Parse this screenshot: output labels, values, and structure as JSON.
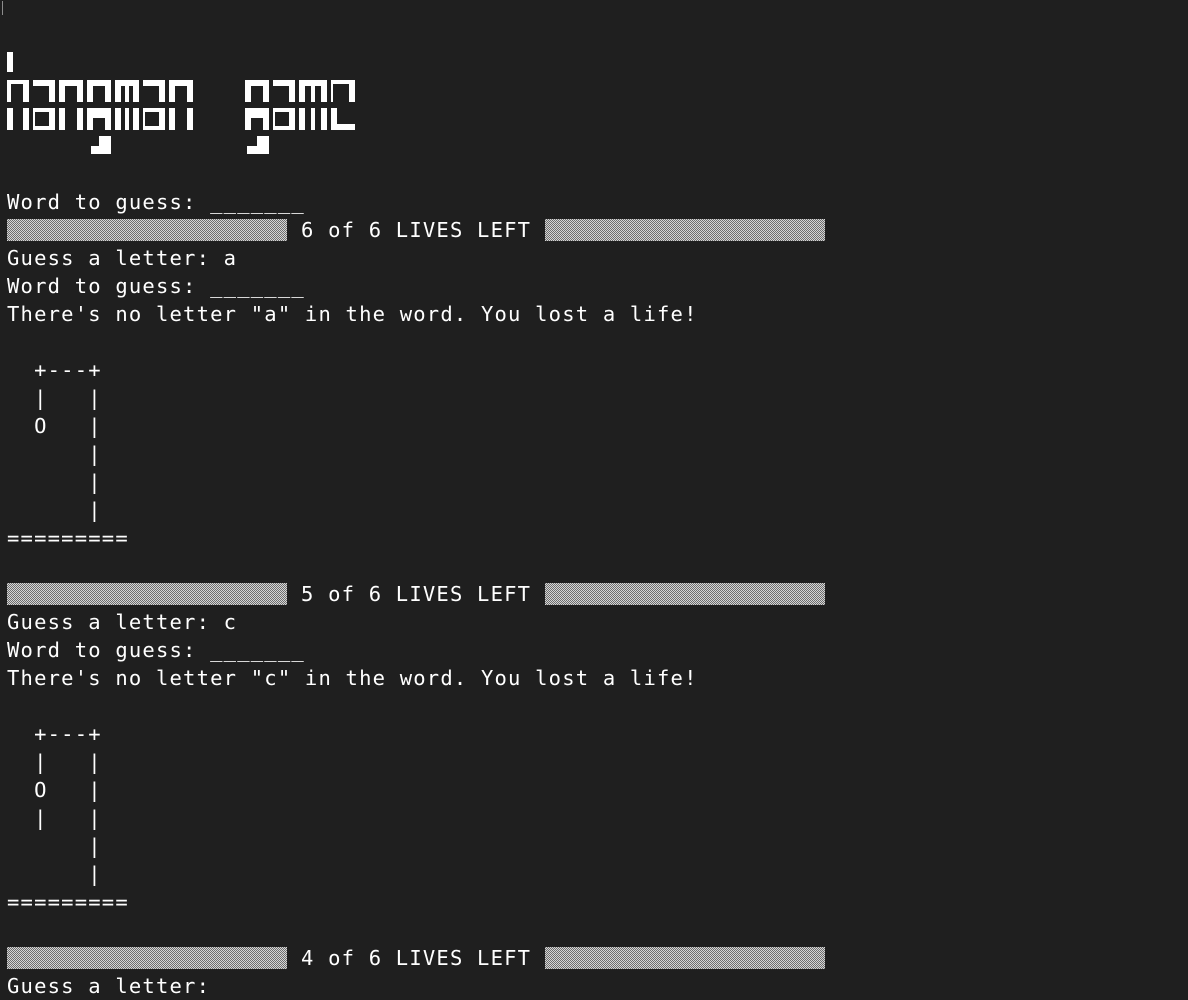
{
  "terminal": {
    "banner_text": "hangman game",
    "initial_word_line": "Word to guess: _______",
    "turns": [
      {
        "lives": "6 of 6 LIVES LEFT",
        "guess_line": "Guess a letter: a",
        "word_line": "Word to guess: _______",
        "message": "There's no letter \"a\" in the word. You lost a life!",
        "gallows": "  +---+\n  |   |\n  O   |\n      |\n      |\n      |\n========="
      },
      {
        "lives": "5 of 6 LIVES LEFT",
        "guess_line": "Guess a letter: c",
        "word_line": "Word to guess: _______",
        "message": "There's no letter \"c\" in the word. You lost a life!",
        "gallows": "  +---+\n  |   |\n  O   |\n  |   |\n      |\n      |\n========="
      },
      {
        "lives": "4 of 6 LIVES LEFT",
        "guess_line": "Guess a letter:"
      }
    ]
  }
}
